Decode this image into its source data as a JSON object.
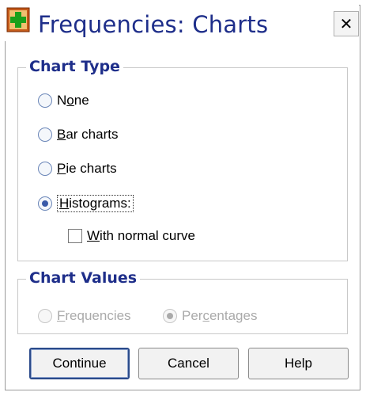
{
  "window": {
    "title": "Frequencies: Charts",
    "close_glyph": "✕",
    "app_icon": "spss-grid-plus-icon"
  },
  "chart_type": {
    "legend": "Chart Type",
    "options": [
      {
        "label": "None",
        "mnemonic_index": 1,
        "selected": false
      },
      {
        "label": "Bar charts",
        "mnemonic_index": 0,
        "selected": false
      },
      {
        "label": "Pie charts",
        "mnemonic_index": 0,
        "selected": false
      },
      {
        "label": "Histograms:",
        "mnemonic_index": 0,
        "selected": true
      }
    ],
    "normal_curve": {
      "label": "With normal curve",
      "checked": false
    }
  },
  "chart_values": {
    "legend": "Chart Values",
    "options": [
      {
        "label": "Frequencies",
        "selected": false,
        "enabled": false
      },
      {
        "label": "Percentages",
        "selected": true,
        "enabled": false
      }
    ]
  },
  "buttons": {
    "continue": "Continue",
    "cancel": "Cancel",
    "help": "Help"
  },
  "colors": {
    "title": "#1e2e8a",
    "group_title": "#1e2e8a",
    "radio_dot": "#3a5aa8"
  }
}
